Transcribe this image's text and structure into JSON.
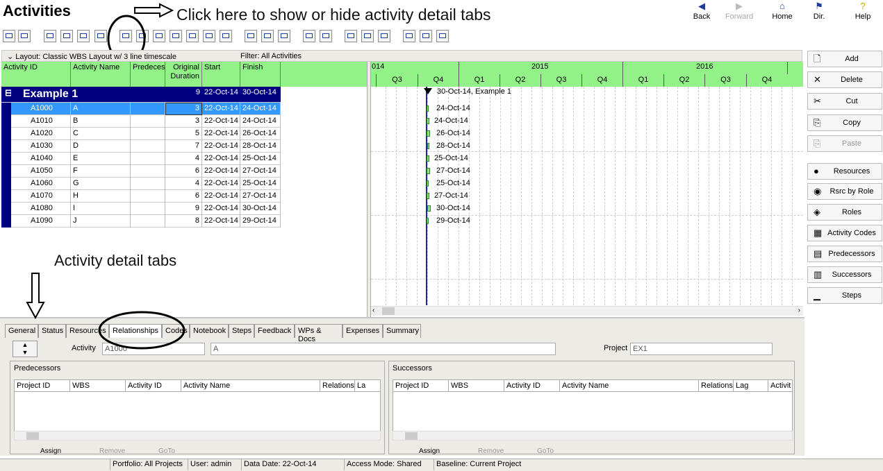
{
  "app": {
    "title": "Activities"
  },
  "nav": [
    {
      "label": "Back",
      "icon": "back-arrow-icon",
      "enabled": true
    },
    {
      "label": "Forward",
      "icon": "forward-arrow-icon",
      "enabled": false
    },
    {
      "label": "Home",
      "icon": "home-icon",
      "enabled": true
    },
    {
      "label": "Dir.",
      "icon": "directory-icon",
      "enabled": true
    },
    {
      "label": "Help",
      "icon": "help-icon",
      "enabled": true
    }
  ],
  "annotations": {
    "click_hint": "Click here to show or hide activity detail tabs",
    "tabs_hint": "Activity detail tabs"
  },
  "toolbar": {
    "layout_label": "Layout: Classic WBS Layout w/ 3 line timescale",
    "filter_label": "Filter: All Activities"
  },
  "grid": {
    "columns": [
      "Activity ID",
      "Activity Name",
      "Predeces",
      "Original Duration",
      "Start",
      "Finish"
    ],
    "wbs": {
      "name": "Example 1",
      "duration": "9",
      "start": "22-Oct-14",
      "finish": "30-Oct-14"
    },
    "rows": [
      {
        "id": "A1000",
        "name": "A",
        "dur": "3",
        "start": "22-Oct-14",
        "finish": "24-Oct-14"
      },
      {
        "id": "A1010",
        "name": "B",
        "dur": "3",
        "start": "22-Oct-14",
        "finish": "24-Oct-14"
      },
      {
        "id": "A1020",
        "name": "C",
        "dur": "5",
        "start": "22-Oct-14",
        "finish": "26-Oct-14"
      },
      {
        "id": "A1030",
        "name": "D",
        "dur": "7",
        "start": "22-Oct-14",
        "finish": "28-Oct-14"
      },
      {
        "id": "A1040",
        "name": "E",
        "dur": "4",
        "start": "22-Oct-14",
        "finish": "25-Oct-14"
      },
      {
        "id": "A1050",
        "name": "F",
        "dur": "6",
        "start": "22-Oct-14",
        "finish": "27-Oct-14"
      },
      {
        "id": "A1060",
        "name": "G",
        "dur": "4",
        "start": "22-Oct-14",
        "finish": "25-Oct-14"
      },
      {
        "id": "A1070",
        "name": "H",
        "dur": "6",
        "start": "22-Oct-14",
        "finish": "27-Oct-14"
      },
      {
        "id": "A1080",
        "name": "I",
        "dur": "9",
        "start": "22-Oct-14",
        "finish": "30-Oct-14"
      },
      {
        "id": "A1090",
        "name": "J",
        "dur": "8",
        "start": "22-Oct-14",
        "finish": "29-Oct-14"
      }
    ]
  },
  "gantt": {
    "years": [
      "014",
      "2015",
      "2016"
    ],
    "quarters": [
      "Q3",
      "Q4",
      "Q1",
      "Q2",
      "Q3",
      "Q4",
      "Q1",
      "Q2",
      "Q3",
      "Q4"
    ],
    "wbs_label": "30-Oct-14, Example 1",
    "bar_labels": [
      "24-Oct-14",
      "24-Oct-14",
      "26-Oct-14",
      "28-Oct-14",
      "25-Oct-14",
      "27-Oct-14",
      "25-Oct-14",
      "27-Oct-14",
      "30-Oct-14",
      "29-Oct-14"
    ]
  },
  "side_buttons": [
    {
      "label": "Add",
      "icon": "add-doc-icon",
      "enabled": true
    },
    {
      "label": "Delete",
      "icon": "delete-x-icon",
      "enabled": true
    },
    {
      "label": "Cut",
      "icon": "scissors-icon",
      "enabled": true
    },
    {
      "label": "Copy",
      "icon": "copy-icon",
      "enabled": true
    },
    {
      "label": "Paste",
      "icon": "paste-icon",
      "enabled": false
    },
    {
      "label": "Resources",
      "icon": "resource-person-icon",
      "enabled": true
    },
    {
      "label": "Rsrc by Role",
      "icon": "resource-role-icon",
      "enabled": true
    },
    {
      "label": "Roles",
      "icon": "roles-icon",
      "enabled": true
    },
    {
      "label": "Activity Codes",
      "icon": "activity-codes-icon",
      "enabled": true
    },
    {
      "label": "Predecessors",
      "icon": "predecessors-icon",
      "enabled": true
    },
    {
      "label": "Successors",
      "icon": "successors-icon",
      "enabled": true
    },
    {
      "label": "Steps",
      "icon": "steps-icon",
      "enabled": true
    }
  ],
  "detail": {
    "tabs": [
      "General",
      "Status",
      "Resources",
      "Relationships",
      "Codes",
      "Notebook",
      "Steps",
      "Feedback",
      "WPs & Docs",
      "Expenses",
      "Summary"
    ],
    "active_tab": "Relationships",
    "activity_label": "Activity",
    "activity_id": "A1000",
    "activity_name": "A",
    "project_label": "Project",
    "project_id": "EX1",
    "pred": {
      "title": "Predecessors",
      "columns": [
        "Project ID",
        "WBS",
        "Activity ID",
        "Activity Name",
        "Relations",
        "La"
      ],
      "buttons": [
        "Assign",
        "Remove",
        "GoTo"
      ]
    },
    "succ": {
      "title": "Successors",
      "columns": [
        "Project ID",
        "WBS",
        "Activity ID",
        "Activity Name",
        "Relations",
        "Lag",
        "Activit"
      ],
      "buttons": [
        "Assign",
        "Remove",
        "GoTo"
      ]
    }
  },
  "status": {
    "portfolio": "Portfolio: All Projects",
    "user": "User: admin",
    "data_date": "Data Date: 22-Oct-14",
    "access": "Access Mode: Shared",
    "baseline": "Baseline: Current Project"
  },
  "colors": {
    "header_green": "#92f287",
    "wbs_band": "#000080",
    "selection": "#3399ff"
  }
}
